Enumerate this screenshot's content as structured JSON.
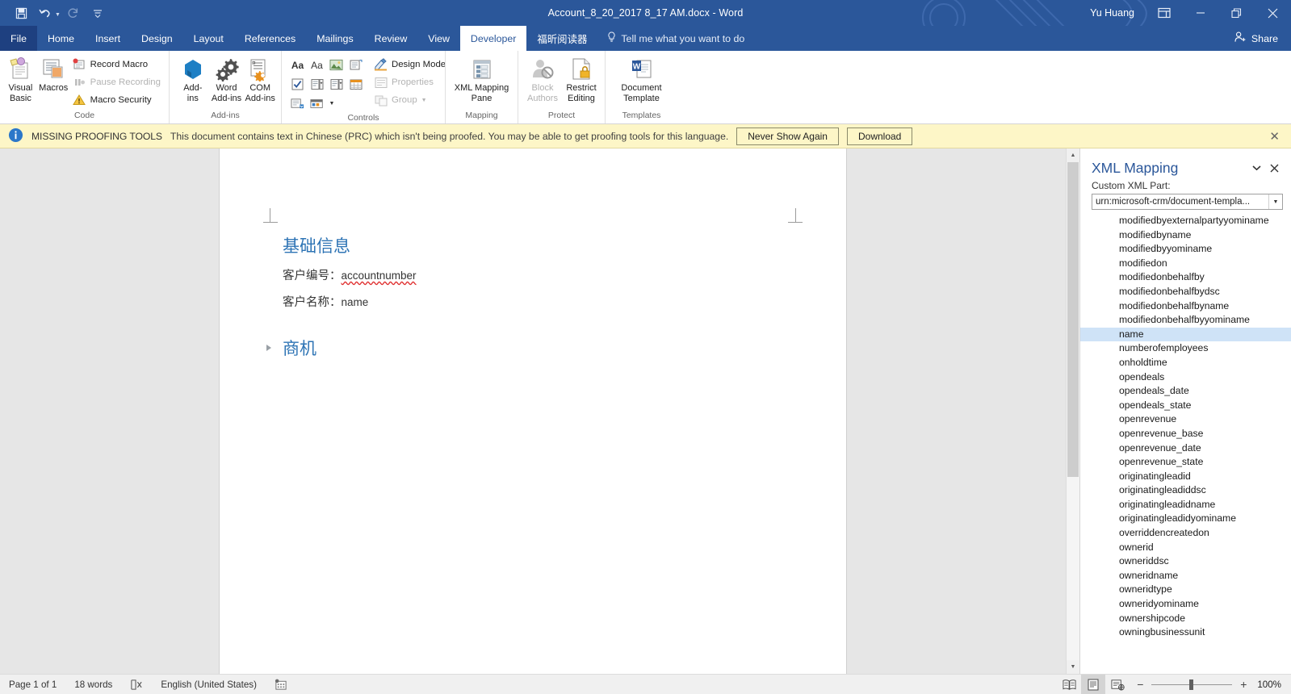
{
  "titlebar": {
    "document_title": "Account_8_20_2017 8_17 AM.docx  -  Word",
    "user": "Yu Huang",
    "quick_access": [
      "save",
      "undo",
      "redo",
      "customize"
    ],
    "ribbon_display_options": "ribbon-display-options",
    "minimize": "Minimize",
    "restore": "Restore Down",
    "close": "Close"
  },
  "tabs": [
    {
      "label": "File",
      "active": false
    },
    {
      "label": "Home",
      "active": false
    },
    {
      "label": "Insert",
      "active": false
    },
    {
      "label": "Design",
      "active": false
    },
    {
      "label": "Layout",
      "active": false
    },
    {
      "label": "References",
      "active": false
    },
    {
      "label": "Mailings",
      "active": false
    },
    {
      "label": "Review",
      "active": false
    },
    {
      "label": "View",
      "active": false
    },
    {
      "label": "Developer",
      "active": true
    },
    {
      "label": "福昕阅读器",
      "active": false
    }
  ],
  "tellme": {
    "label": "Tell me what you want to do"
  },
  "share": {
    "label": "Share"
  },
  "ribbon": {
    "groups": [
      {
        "label": "Code",
        "big_buttons": [
          {
            "label_line1": "Visual",
            "label_line2": "Basic",
            "disabled": false
          },
          {
            "label_line1": "Macros",
            "label_line2": "",
            "disabled": false
          }
        ],
        "small_buttons": [
          {
            "label": "Record Macro",
            "disabled": false
          },
          {
            "label": "Pause Recording",
            "disabled": true
          },
          {
            "label": "Macro Security",
            "disabled": false
          }
        ]
      },
      {
        "label": "Add-ins",
        "big_buttons": [
          {
            "label_line1": "Add-",
            "label_line2": "ins",
            "disabled": false
          },
          {
            "label_line1": "Word",
            "label_line2": "Add-ins",
            "disabled": false
          },
          {
            "label_line1": "COM",
            "label_line2": "Add-ins",
            "disabled": false
          }
        ],
        "small_buttons": []
      },
      {
        "label": "Controls",
        "big_buttons": [],
        "small_buttons": [
          {
            "label": "Design Mode",
            "disabled": false
          },
          {
            "label": "Properties",
            "disabled": true
          },
          {
            "label": "Group",
            "disabled": true
          }
        ],
        "control_cells": [
          "rich-text-content-control",
          "plain-text-content-control",
          "picture-content-control",
          "building-block-gallery-content-control",
          "checkbox-content-control",
          "combo-box-content-control",
          "drop-down-list-content-control",
          "date-picker-content-control",
          "repeating-section-content-control",
          "legacy-tools"
        ]
      },
      {
        "label": "Mapping",
        "big_buttons": [
          {
            "label_line1": "XML Mapping",
            "label_line2": "Pane",
            "disabled": false
          }
        ],
        "small_buttons": []
      },
      {
        "label": "Protect",
        "big_buttons": [
          {
            "label_line1": "Block",
            "label_line2": "Authors",
            "disabled": true
          },
          {
            "label_line1": "Restrict",
            "label_line2": "Editing",
            "disabled": false
          }
        ],
        "small_buttons": []
      },
      {
        "label": "Templates",
        "big_buttons": [
          {
            "label_line1": "Document",
            "label_line2": "Template",
            "disabled": false
          }
        ],
        "small_buttons": []
      }
    ]
  },
  "message_bar": {
    "label": "MISSING PROOFING TOOLS",
    "text": "This document contains text in Chinese (PRC) which isn't being proofed. You may be able to get proofing tools for this language.",
    "buttons": [
      "Never Show Again",
      "Download"
    ],
    "close": "✕",
    "background": "#fdf6c7"
  },
  "document": {
    "heading1": "基础信息",
    "field1_label": "客户编号：",
    "field1_value": "accountnumber",
    "field2_label": "客户名称：",
    "field2_value": "name",
    "heading2": "商机",
    "heading_color": "#2e74b5"
  },
  "pane": {
    "title": "XML Mapping",
    "menu_icon": "chevron-down-icon",
    "close_icon": "close-icon",
    "subtitle": "Custom XML Part:",
    "selected_part": "urn:microsoft-crm/document-templa...",
    "items": [
      {
        "label": "modifiedbyexternalpartyyominame",
        "selected": false
      },
      {
        "label": "modifiedbyname",
        "selected": false
      },
      {
        "label": "modifiedbyyominame",
        "selected": false
      },
      {
        "label": "modifiedon",
        "selected": false
      },
      {
        "label": "modifiedonbehalfby",
        "selected": false
      },
      {
        "label": "modifiedonbehalfbydsc",
        "selected": false
      },
      {
        "label": "modifiedonbehalfbyname",
        "selected": false
      },
      {
        "label": "modifiedonbehalfbyyominame",
        "selected": false
      },
      {
        "label": "name",
        "selected": true
      },
      {
        "label": "numberofemployees",
        "selected": false
      },
      {
        "label": "onholdtime",
        "selected": false
      },
      {
        "label": "opendeals",
        "selected": false
      },
      {
        "label": "opendeals_date",
        "selected": false
      },
      {
        "label": "opendeals_state",
        "selected": false
      },
      {
        "label": "openrevenue",
        "selected": false
      },
      {
        "label": "openrevenue_base",
        "selected": false
      },
      {
        "label": "openrevenue_date",
        "selected": false
      },
      {
        "label": "openrevenue_state",
        "selected": false
      },
      {
        "label": "originatingleadid",
        "selected": false
      },
      {
        "label": "originatingleadiddsc",
        "selected": false
      },
      {
        "label": "originatingleadidname",
        "selected": false
      },
      {
        "label": "originatingleadidyominame",
        "selected": false
      },
      {
        "label": "overriddencreatedon",
        "selected": false
      },
      {
        "label": "ownerid",
        "selected": false
      },
      {
        "label": "owneriddsc",
        "selected": false
      },
      {
        "label": "owneridname",
        "selected": false
      },
      {
        "label": "owneridtype",
        "selected": false
      },
      {
        "label": "owneridyominame",
        "selected": false
      },
      {
        "label": "ownershipcode",
        "selected": false
      },
      {
        "label": "owningbusinessunit",
        "selected": false
      }
    ]
  },
  "statusbar": {
    "page": "Page 1 of 1",
    "words": "18 words",
    "proofing_icon": "proofing-errors-icon",
    "language": "English (United States)",
    "macro_icon": "record-macro-icon",
    "views": [
      "read-mode",
      "print-layout",
      "web-layout"
    ],
    "active_view": "print-layout",
    "zoom_level": "100%"
  },
  "colors": {
    "accent": "#2b579a",
    "heading": "#2e74b5",
    "selection": "#cfe3f7",
    "warning_bg": "#fdf6c7"
  }
}
